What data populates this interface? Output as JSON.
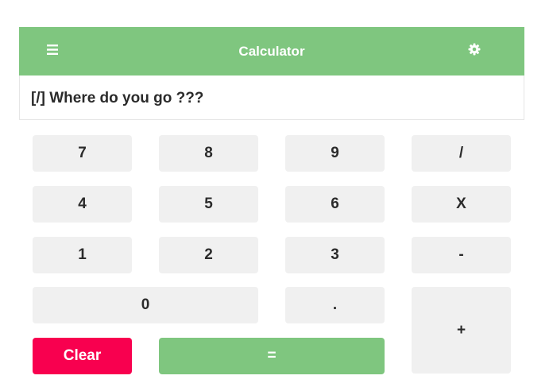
{
  "header": {
    "title": "Calculator",
    "menu_icon": "hamburger-menu-icon",
    "settings_icon": "gear-icon"
  },
  "display": {
    "text": "[/] Where do you go ???"
  },
  "keys": {
    "k7": "7",
    "k8": "8",
    "k9": "9",
    "divide": "/",
    "k4": "4",
    "k5": "5",
    "k6": "6",
    "multiply": "X",
    "k1": "1",
    "k2": "2",
    "k3": "3",
    "minus": "-",
    "k0": "0",
    "dot": ".",
    "plus": "+",
    "clear": "Clear",
    "equals": "="
  },
  "colors": {
    "header_bg": "#7fc67f",
    "clear_bg": "#f8004f",
    "equals_bg": "#7fc67f",
    "key_bg": "#f0f0f0"
  }
}
